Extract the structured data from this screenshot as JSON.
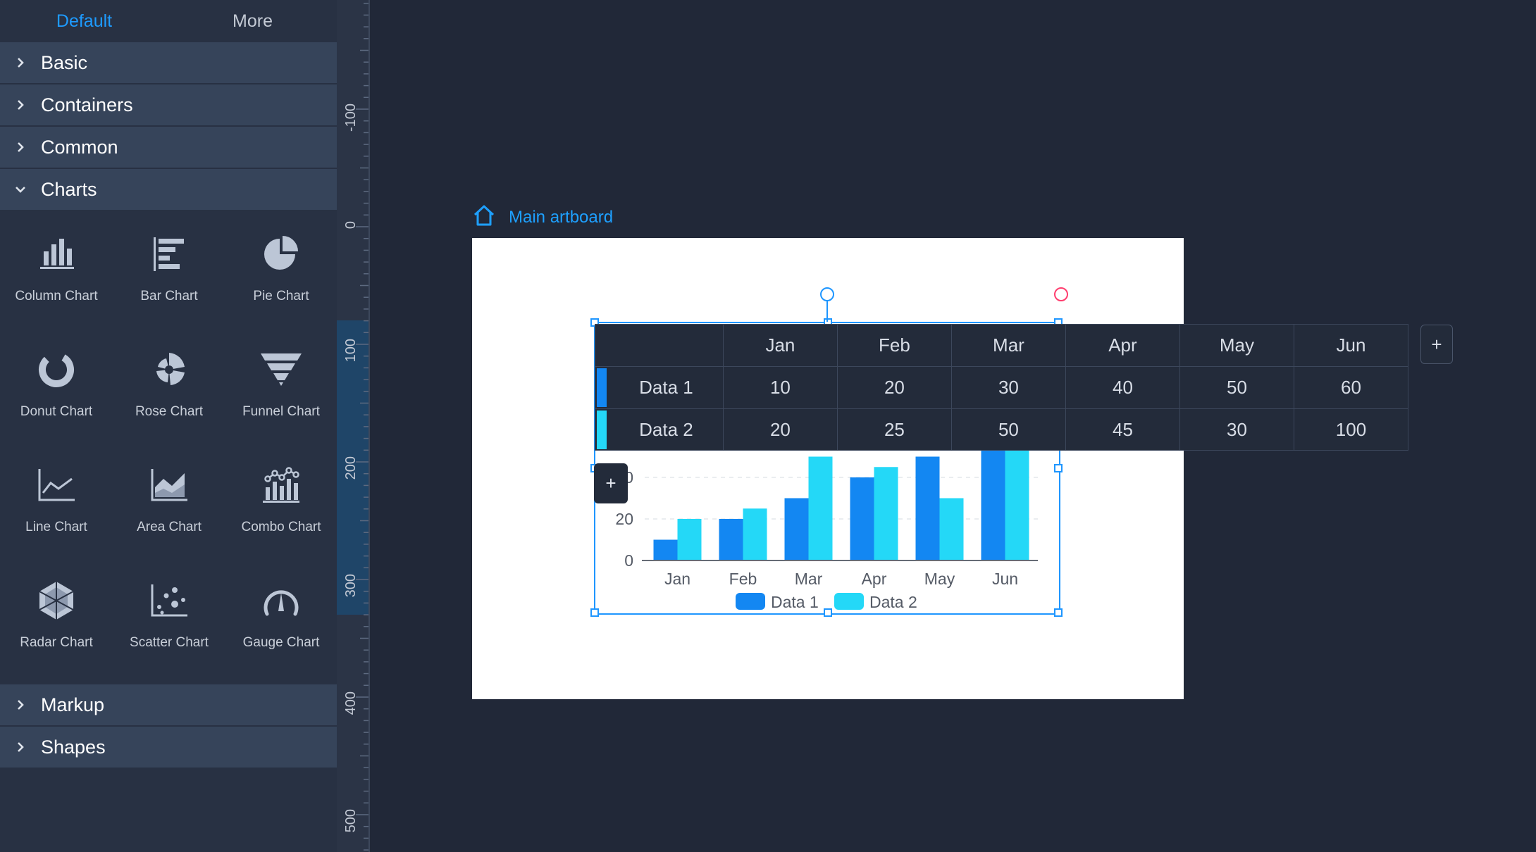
{
  "sidebar": {
    "tabs": [
      {
        "label": "Default",
        "active": true
      },
      {
        "label": "More",
        "active": false
      }
    ],
    "sections_top": [
      {
        "label": "Basic",
        "expanded": false
      },
      {
        "label": "Containers",
        "expanded": false
      },
      {
        "label": "Common",
        "expanded": false
      },
      {
        "label": "Charts",
        "expanded": true
      }
    ],
    "chart_items": [
      {
        "label": "Column Chart",
        "icon": "column-chart-icon"
      },
      {
        "label": "Bar Chart",
        "icon": "bar-chart-icon"
      },
      {
        "label": "Pie Chart",
        "icon": "pie-chart-icon"
      },
      {
        "label": "Donut Chart",
        "icon": "donut-chart-icon"
      },
      {
        "label": "Rose Chart",
        "icon": "rose-chart-icon"
      },
      {
        "label": "Funnel Chart",
        "icon": "funnel-chart-icon"
      },
      {
        "label": "Line Chart",
        "icon": "line-chart-icon"
      },
      {
        "label": "Area Chart",
        "icon": "area-chart-icon"
      },
      {
        "label": "Combo Chart",
        "icon": "combo-chart-icon"
      },
      {
        "label": "Radar Chart",
        "icon": "radar-chart-icon"
      },
      {
        "label": "Scatter Chart",
        "icon": "scatter-chart-icon"
      },
      {
        "label": "Gauge Chart",
        "icon": "gauge-chart-icon"
      }
    ],
    "sections_bottom": [
      {
        "label": "Markup",
        "expanded": false
      },
      {
        "label": "Shapes",
        "expanded": false
      }
    ]
  },
  "ruler": {
    "labels": [
      "-100",
      "0",
      "100",
      "200",
      "300",
      "400",
      "500"
    ]
  },
  "canvas": {
    "breadcrumb": "Main artboard"
  },
  "data_table": {
    "columns": [
      "Jan",
      "Feb",
      "Mar",
      "Apr",
      "May",
      "Jun"
    ],
    "rows": [
      {
        "name": "Data 1",
        "color": "#1387f2",
        "values": [
          "10",
          "20",
          "30",
          "40",
          "50",
          "60"
        ]
      },
      {
        "name": "Data 2",
        "color": "#24d8f7",
        "values": [
          "20",
          "25",
          "50",
          "45",
          "30",
          "100"
        ]
      }
    ],
    "add_column_label": "+",
    "add_row_label": "+"
  },
  "colors": {
    "accent": "#1e9bff",
    "series1": "#1387f2",
    "series2": "#24d8f7",
    "delete": "#ff3d6e"
  },
  "chart_data": {
    "type": "bar",
    "categories": [
      "Jan",
      "Feb",
      "Mar",
      "Apr",
      "May",
      "Jun"
    ],
    "series": [
      {
        "name": "Data 1",
        "values": [
          10,
          20,
          30,
          40,
          50,
          60
        ]
      },
      {
        "name": "Data 2",
        "values": [
          20,
          25,
          50,
          45,
          30,
          100
        ]
      }
    ],
    "y_tick_labels": [
      "0",
      "20",
      "0"
    ],
    "ylim": [
      0,
      50
    ],
    "legend": "bottom",
    "grid": true
  }
}
